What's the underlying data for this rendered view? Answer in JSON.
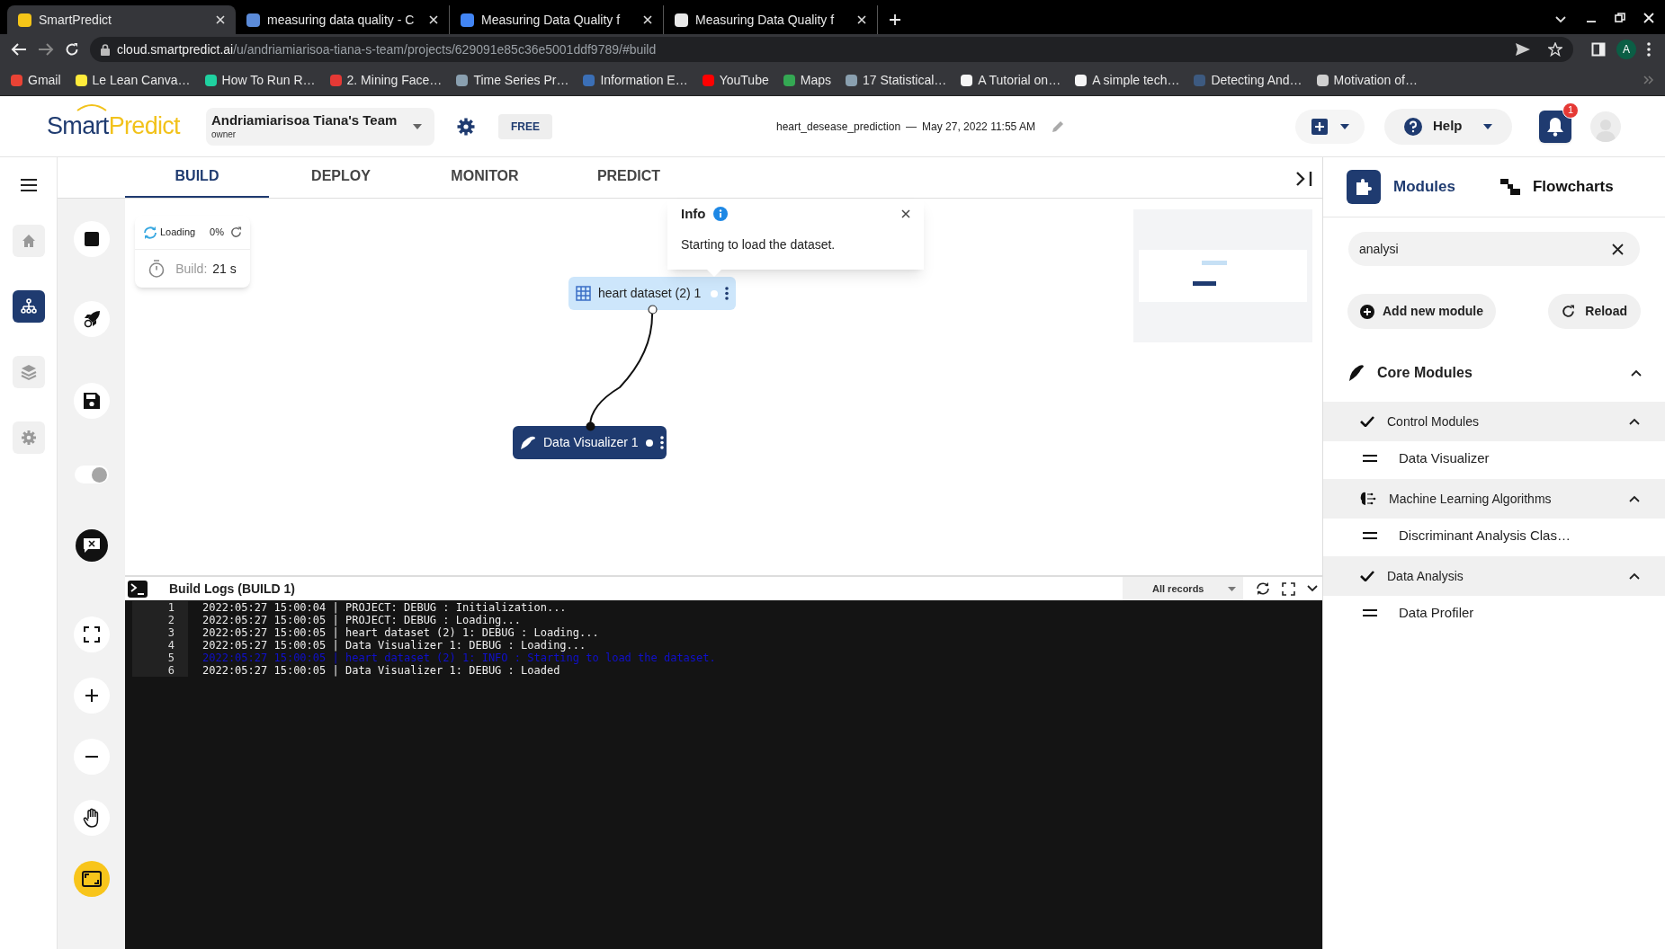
{
  "browser": {
    "tabs": [
      {
        "title": "SmartPredict",
        "selected": true,
        "color": "#f5c518"
      },
      {
        "title": "measuring data quality - C",
        "selected": false,
        "color": "#5b8bd9"
      },
      {
        "title": "Measuring Data Quality f",
        "selected": false,
        "color": "#4285f4"
      },
      {
        "title": "Measuring Data Quality f",
        "selected": false,
        "color": "#e8e8e8"
      }
    ],
    "url": {
      "host": "cloud.smartpredict.ai",
      "path": "/u/andriamiarisoa-tiana-s-team/projects/629091e85c36e5001ddf9789/#build"
    },
    "profile_initial": "A",
    "bookmarks": [
      {
        "label": "Gmail",
        "color": "#ea4335"
      },
      {
        "label": "Le Lean Canva…",
        "color": "#ffeb3b"
      },
      {
        "label": "How To Run R…",
        "color": "#1fd1a0"
      },
      {
        "label": "2. Mining Face…",
        "color": "#e53935"
      },
      {
        "label": "Time Series Pr…",
        "color": "#8aa0b0"
      },
      {
        "label": "Information E…",
        "color": "#3b6fb6"
      },
      {
        "label": "YouTube",
        "color": "#ff0000"
      },
      {
        "label": "Maps",
        "color": "#34a853"
      },
      {
        "label": "17 Statistical…",
        "color": "#8aa0b0"
      },
      {
        "label": "A Tutorial on…",
        "color": "#f5f5f5"
      },
      {
        "label": "A simple tech…",
        "color": "#f5f5f5"
      },
      {
        "label": "Detecting And…",
        "color": "#3d5a80"
      },
      {
        "label": "Motivation of…",
        "color": "#d0d0d0"
      }
    ]
  },
  "header": {
    "logo_dark": "Smart",
    "logo_light": "Predict",
    "team": "Andriamiarisoa Tiana's Team",
    "role": "owner",
    "plan": "FREE",
    "project": "heart_desease_prediction",
    "separator": "—",
    "date": "May 27, 2022 11:55 AM",
    "help": "Help",
    "notifications": "1"
  },
  "nav": [
    {
      "kind": "home",
      "selected": false
    },
    {
      "kind": "flow",
      "selected": true
    },
    {
      "kind": "layers",
      "selected": false
    },
    {
      "kind": "settings",
      "selected": false
    }
  ],
  "tabs": [
    {
      "label": "BUILD",
      "selected": true
    },
    {
      "label": "DEPLOY",
      "selected": false
    },
    {
      "label": "MONITOR",
      "selected": false
    },
    {
      "label": "PREDICT",
      "selected": false
    }
  ],
  "toolbar": {
    "toggle_on": true
  },
  "status": {
    "state": "Loading",
    "percent": "0%",
    "build_label": "Build:",
    "build_time": "21 s"
  },
  "popup": {
    "title": "Info",
    "message": "Starting to load the dataset."
  },
  "nodes": [
    {
      "label": "heart dataset (2) 1",
      "kind": "dataset"
    },
    {
      "label": "Data Visualizer 1",
      "kind": "visualizer"
    }
  ],
  "logs": {
    "title": "Build Logs (BUILD 1)",
    "filter": "All records",
    "lines": [
      {
        "number": "1",
        "text": "2022:05:27 15:00:04 | PROJECT: DEBUG : Initialization...",
        "kind": "debug"
      },
      {
        "number": "2",
        "text": "2022:05:27 15:00:05 | PROJECT: DEBUG : Loading...",
        "kind": "debug"
      },
      {
        "number": "3",
        "text": "2022:05:27 15:00:05 | heart dataset (2) 1: DEBUG : Loading...",
        "kind": "debug"
      },
      {
        "number": "4",
        "text": "2022:05:27 15:00:05 | Data Visualizer 1: DEBUG : Loading...",
        "kind": "debug"
      },
      {
        "number": "5",
        "text": "2022:05:27 15:00:05 | heart dataset (2) 1: INFO : Starting to load the dataset.",
        "kind": "info"
      },
      {
        "number": "6",
        "text": "2022:05:27 15:00:05 | Data Visualizer 1: DEBUG : Loaded",
        "kind": "debug"
      }
    ]
  },
  "panel": {
    "tabs": [
      {
        "label": "Modules",
        "selected": true
      },
      {
        "label": "Flowcharts",
        "selected": false
      }
    ],
    "search": {
      "value": "analysi"
    },
    "buttons": [
      "Add new module",
      "Reload"
    ],
    "section": {
      "title": "Core Modules",
      "expanded": true,
      "groups": [
        {
          "title": "Control Modules",
          "kind": "check",
          "expanded": true,
          "items": [
            "Data Visualizer"
          ]
        },
        {
          "title": "Machine Learning Algorithms",
          "kind": "brain",
          "expanded": true,
          "items": [
            "Discriminant Analysis Clas…"
          ]
        },
        {
          "title": "Data Analysis",
          "kind": "check",
          "expanded": true,
          "items": [
            "Data Profiler"
          ]
        }
      ]
    }
  }
}
